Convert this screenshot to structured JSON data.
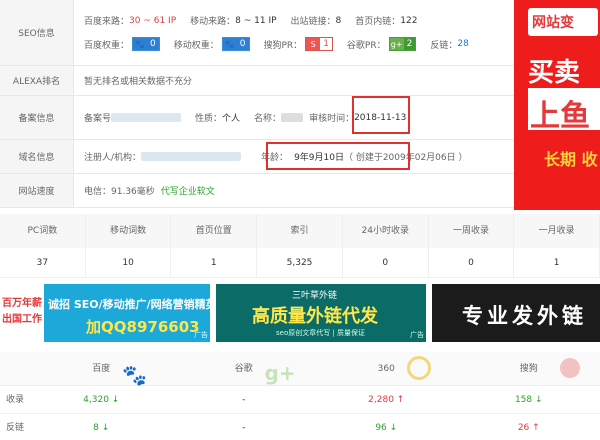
{
  "seo": {
    "label": "SEO信息",
    "baidu_source_label": "百度来路：",
    "baidu_source_value": "30 ~ 61 IP",
    "mobile_source_label": "移动来路：",
    "mobile_source_value": "8 ~ 11 IP",
    "out_links_label": "出站链接：",
    "out_links_value": "8",
    "home_links_label": "首页内链：",
    "home_links_value": "122",
    "baidu_weight_label": "百度权重：",
    "baidu_weight_value": "0",
    "mobile_weight_label": "移动权重：",
    "mobile_weight_value": "0",
    "sogou_pr_label": "搜狗PR：",
    "sogou_pr_value": "1",
    "google_pr_label": "谷歌PR：",
    "google_pr_value": "2",
    "backlinks_label": "反链：",
    "backlinks_value": "28"
  },
  "alexa": {
    "label": "ALEXA排名",
    "value": "暂无排名或相关数据不充分"
  },
  "beian": {
    "label": "备案信息",
    "id_label": "备案号",
    "nature_label": "性质：",
    "nature_value": "个人",
    "name_label": "名称：",
    "time_label": "审核时间：",
    "time_value": "2018-11-13"
  },
  "domain": {
    "label": "域名信息",
    "owner_label": "注册人/机构：",
    "age_label": "年龄：",
    "age_value": "9年9月10日",
    "created_value": "（ 创建于2009年02月06日 ）"
  },
  "speed": {
    "label": "网站速度",
    "value": "电信：91.36毫秒",
    "link": "代写企业软文"
  },
  "stats": {
    "headers": [
      "PC词数",
      "移动词数",
      "首页位置",
      "索引",
      "24小时收录",
      "一周收录",
      "一月收录"
    ],
    "values": [
      "37",
      "10",
      "1",
      "5,325",
      "0",
      "0",
      "1"
    ]
  },
  "banners": {
    "b1_left": "百万年薪",
    "b1_left2": "出国工作",
    "b1_main": "诚招 SEO/移动推广/网络营销精英",
    "b1_qq": "加QQ8976603",
    "b1_ad": "广告",
    "b2_top": "三叶草外链",
    "b2_main": "高质量外链代发",
    "b2_sub": "seo原创文章代写 | 质量保证",
    "b2_ad": "广告",
    "b3_main": "专业发外链"
  },
  "engines": {
    "headers": [
      "百度",
      "谷歌",
      "360",
      "搜狗"
    ],
    "row1_label": "收录",
    "row1": [
      "4,320",
      "-",
      "2,280",
      "158"
    ],
    "row2_label": "反链",
    "row2": [
      "8",
      "-",
      "96",
      "26"
    ]
  },
  "ad": {
    "line1": "网站变",
    "line2": "买卖网",
    "line3": "上鱼",
    "line4": "长期 收"
  },
  "colors": {
    "accent_red": "#e4393c",
    "link_blue": "#1a7bd6",
    "green": "#2aa52a",
    "ad_red": "#ef1c1c"
  }
}
